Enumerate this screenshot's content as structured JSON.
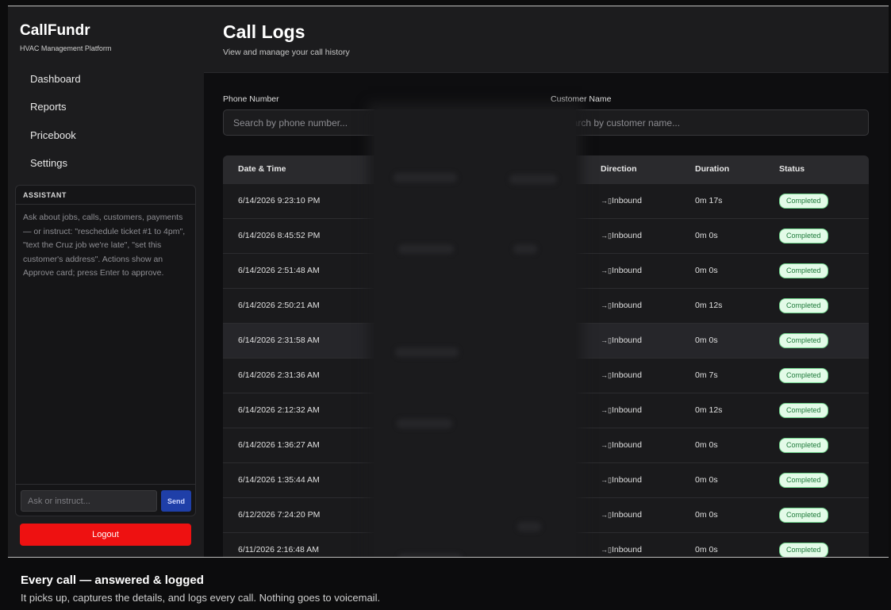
{
  "brand": {
    "name": "CallFundr",
    "tagline": "HVAC Management Platform"
  },
  "nav": [
    {
      "label": "Dashboard"
    },
    {
      "label": "Reports"
    },
    {
      "label": "Pricebook"
    },
    {
      "label": "Settings"
    }
  ],
  "assistant": {
    "title": "ASSISTANT",
    "hint": "Ask about jobs, calls, customers, payments — or instruct: \"reschedule ticket #1 to 4pm\", \"text the Cruz job we're late\", \"set this customer's address\". Actions show an Approve card; press Enter to approve.",
    "input_placeholder": "Ask or instruct...",
    "send_label": "Send"
  },
  "logout_label": "Logout",
  "page": {
    "title": "Call Logs",
    "subtitle": "View and manage your call history"
  },
  "filters": {
    "phone_label": "Phone Number",
    "phone_placeholder": "Search by phone number...",
    "customer_label": "Customer Name",
    "customer_placeholder": "Search by customer name..."
  },
  "table": {
    "headers": {
      "datetime": "Date & Time",
      "direction": "Direction",
      "duration": "Duration",
      "status": "Status"
    },
    "rows": [
      {
        "datetime": "6/14/2026 9:23:10 PM",
        "direction": "Inbound",
        "duration": "0m 17s",
        "status": "Completed"
      },
      {
        "datetime": "6/14/2026 8:45:52 PM",
        "direction": "Inbound",
        "duration": "0m 0s",
        "status": "Completed"
      },
      {
        "datetime": "6/14/2026 2:51:48 AM",
        "direction": "Inbound",
        "duration": "0m 0s",
        "status": "Completed"
      },
      {
        "datetime": "6/14/2026 2:50:21 AM",
        "direction": "Inbound",
        "duration": "0m 12s",
        "status": "Completed"
      },
      {
        "datetime": "6/14/2026 2:31:58 AM",
        "direction": "Inbound",
        "duration": "0m 0s",
        "status": "Completed"
      },
      {
        "datetime": "6/14/2026 2:31:36 AM",
        "direction": "Inbound",
        "duration": "0m 7s",
        "status": "Completed"
      },
      {
        "datetime": "6/14/2026 2:12:32 AM",
        "direction": "Inbound",
        "duration": "0m 12s",
        "status": "Completed"
      },
      {
        "datetime": "6/14/2026 1:36:27 AM",
        "direction": "Inbound",
        "duration": "0m 0s",
        "status": "Completed"
      },
      {
        "datetime": "6/14/2026 1:35:44 AM",
        "direction": "Inbound",
        "duration": "0m 0s",
        "status": "Completed"
      },
      {
        "datetime": "6/12/2026 7:24:20 PM",
        "direction": "Inbound",
        "duration": "0m 0s",
        "status": "Completed"
      },
      {
        "datetime": "6/11/2026 2:16:48 AM",
        "direction": "Inbound",
        "duration": "0m 0s",
        "status": "Completed"
      }
    ]
  },
  "footer": {
    "title": "Every call — answered & logged",
    "subtitle": "It picks up, captures the details, and logs every call. Nothing goes to voicemail."
  },
  "icons": {
    "direction": "inbound-call-icon"
  },
  "colors": {
    "accent": "#1f3fa8",
    "danger": "#ee1111",
    "status_success_bg": "#e3fbe8",
    "status_success_text": "#1e7a3a"
  }
}
